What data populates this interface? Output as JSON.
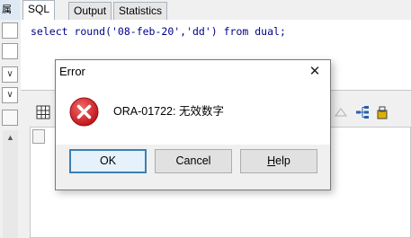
{
  "left_strip": {
    "tab_label": "属"
  },
  "tabs": [
    {
      "label": "SQL"
    },
    {
      "label": "Output"
    },
    {
      "label": "Statistics"
    }
  ],
  "editor": {
    "code": "select round('08-feb-20','dd') from dual;"
  },
  "dialog": {
    "title": "Error",
    "message": "ORA-01722: 无效数字",
    "buttons": {
      "ok": "OK",
      "cancel": "Cancel",
      "help_first": "H",
      "help_rest": "elp"
    }
  },
  "colors": {
    "code_text": "#00008b",
    "error_red": "#d9252a",
    "default_button_border": "#3c7fb1"
  },
  "icons": [
    "grid-icon",
    "error-icon",
    "close-icon",
    "chevron-down-icon",
    "arrow-up-icon"
  ]
}
